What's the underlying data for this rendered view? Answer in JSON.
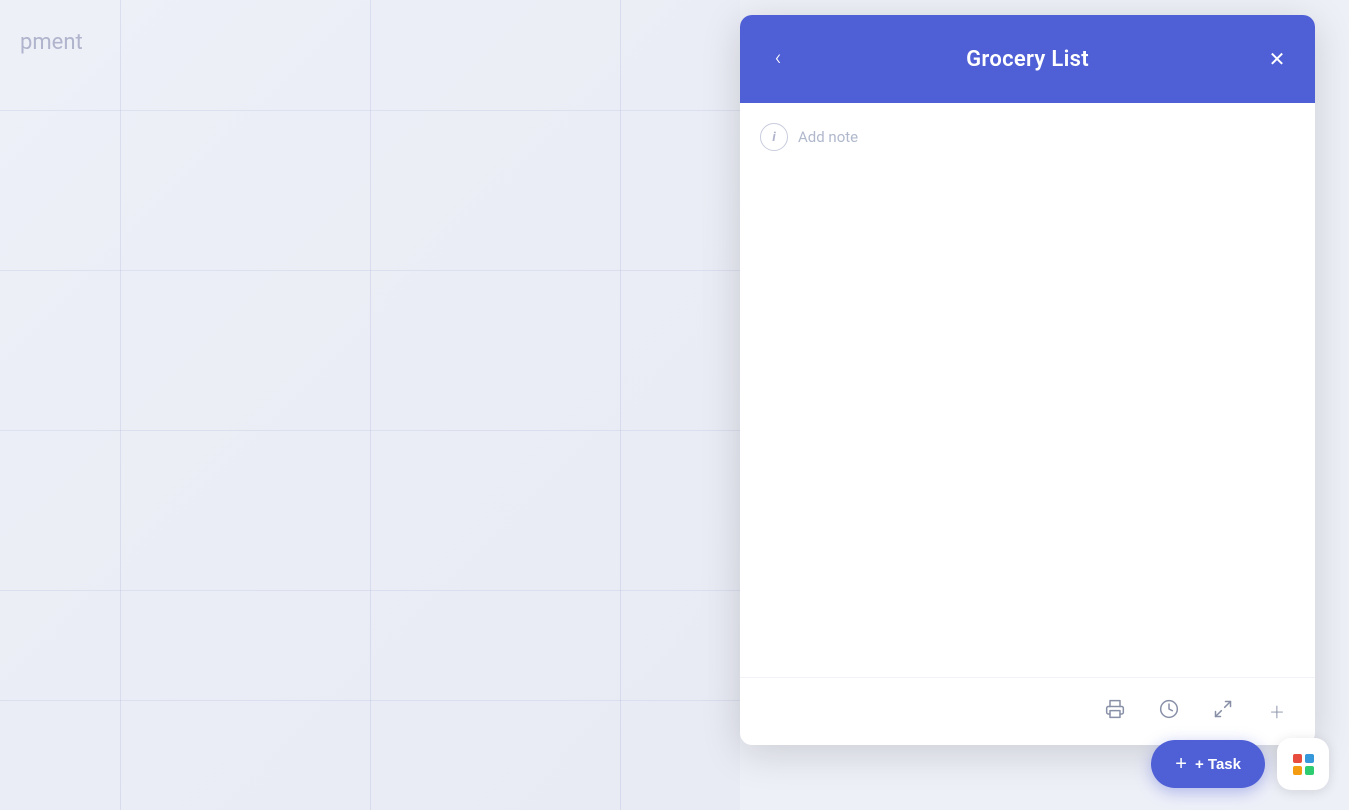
{
  "background": {
    "partial_text": "pment"
  },
  "panel": {
    "header": {
      "title": "Grocery List",
      "back_label": "‹",
      "close_label": "✕"
    },
    "body": {
      "add_note_placeholder": "Add note"
    },
    "footer": {
      "print_icon": "🖨",
      "history_icon": "🕐",
      "expand_icon": "⤢",
      "add_icon": "+"
    }
  },
  "bottom_actions": {
    "add_task_label": "+ Task"
  },
  "apps_dots": [
    {
      "color": "#e74c3c"
    },
    {
      "color": "#3498db"
    },
    {
      "color": "#f39c12"
    },
    {
      "color": "#2ecc71"
    }
  ]
}
